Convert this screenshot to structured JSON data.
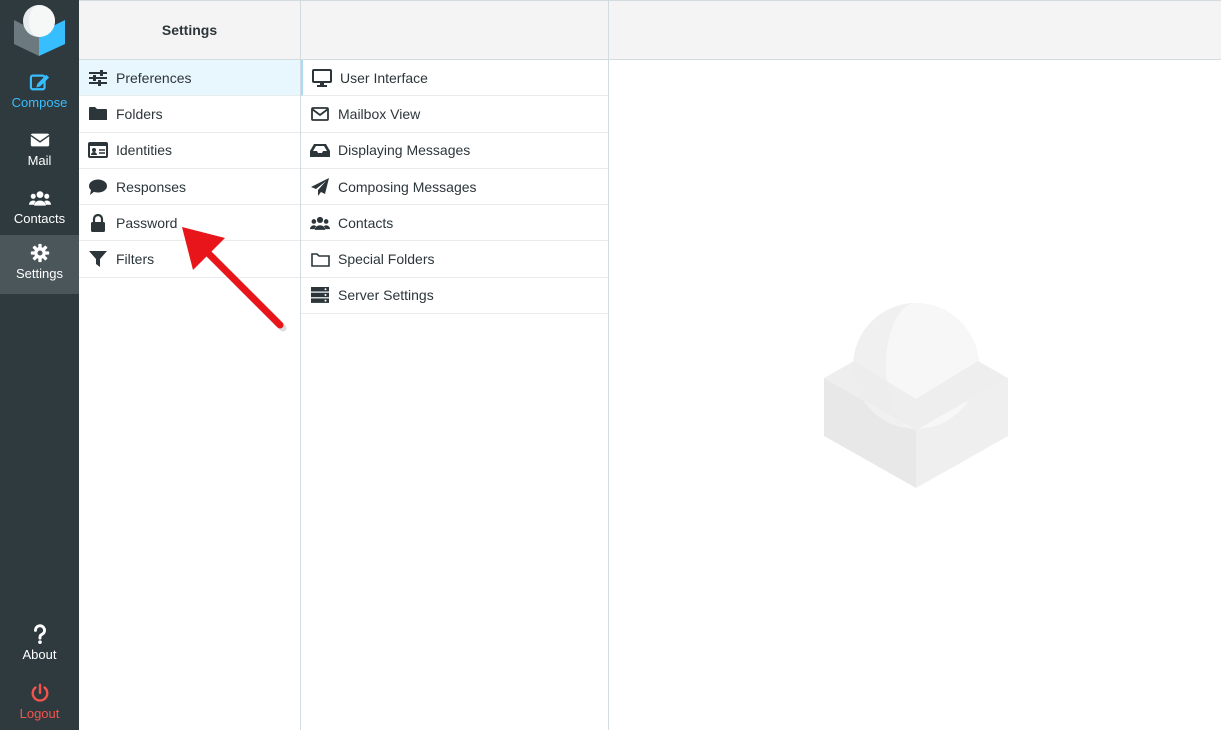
{
  "nav": {
    "compose": "Compose",
    "mail": "Mail",
    "contacts": "Contacts",
    "settings": "Settings",
    "about": "About",
    "logout": "Logout"
  },
  "settings_panel": {
    "title": "Settings",
    "items": [
      {
        "label": "Preferences",
        "icon": "sliders-icon"
      },
      {
        "label": "Folders",
        "icon": "folder-icon"
      },
      {
        "label": "Identities",
        "icon": "id-card-icon"
      },
      {
        "label": "Responses",
        "icon": "comment-icon"
      },
      {
        "label": "Password",
        "icon": "lock-icon"
      },
      {
        "label": "Filters",
        "icon": "filter-icon"
      }
    ]
  },
  "preferences_panel": {
    "items": [
      {
        "label": "User Interface",
        "icon": "desktop-icon"
      },
      {
        "label": "Mailbox View",
        "icon": "envelope-outline-icon"
      },
      {
        "label": "Displaying Messages",
        "icon": "inbox-icon"
      },
      {
        "label": "Composing Messages",
        "icon": "paper-plane-icon"
      },
      {
        "label": "Contacts",
        "icon": "users-icon"
      },
      {
        "label": "Special Folders",
        "icon": "folder-outline-icon"
      },
      {
        "label": "Server Settings",
        "icon": "server-icon"
      }
    ]
  },
  "colors": {
    "nav_bg": "#2f3a3f",
    "accent": "#37beff",
    "logout": "#f4544c",
    "arrow": "#e8161a"
  }
}
